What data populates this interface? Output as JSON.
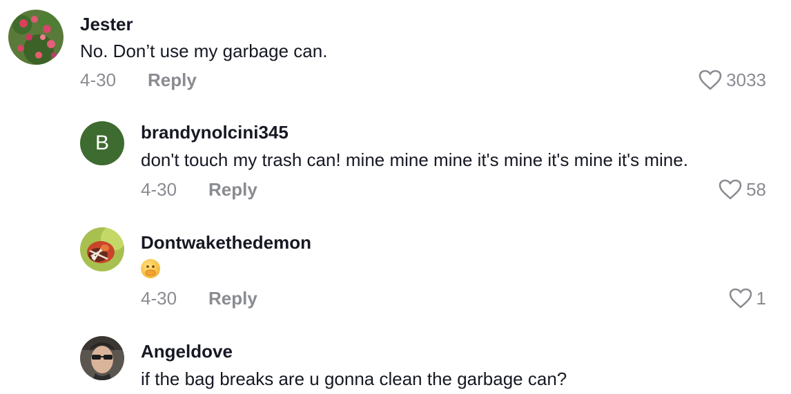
{
  "comments": [
    {
      "username": "Jester",
      "text": "No. Don’t use my garbage can.",
      "date": "4-30",
      "reply_label": "Reply",
      "likes": "3033",
      "avatar_icon": "flowers-avatar"
    },
    {
      "username": "brandynolcini345",
      "text": "don't touch my trash can! mine mine mine it's mine it's mine it's mine.",
      "date": "4-30",
      "reply_label": "Reply",
      "likes": "58",
      "avatar_letter": "B",
      "avatar_color": "#3e6b30"
    },
    {
      "username": "Dontwakethedemon",
      "text": "",
      "emoji_icon": "hand-over-mouth-emoji",
      "date": "4-30",
      "reply_label": "Reply",
      "likes": "1",
      "avatar_icon": "butterfly-avatar"
    },
    {
      "username": "Angeldove",
      "text": "if the bag breaks are u gonna clean the garbage can?",
      "avatar_icon": "person-avatar"
    }
  ]
}
